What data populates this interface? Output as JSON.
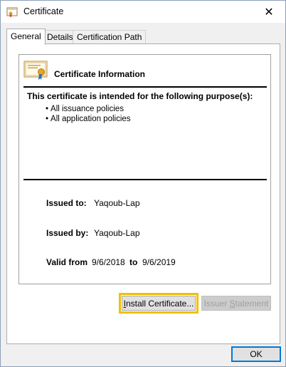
{
  "window": {
    "title": "Certificate"
  },
  "tabs": [
    {
      "label": "General",
      "active": true
    },
    {
      "label": "Details",
      "active": false
    },
    {
      "label": "Certification Path",
      "active": false
    }
  ],
  "info": {
    "title": "Certificate Information",
    "purpose_heading": "This certificate is intended for the following purpose(s):",
    "purposes": [
      "All issuance policies",
      "All application policies"
    ]
  },
  "fields": {
    "issued_to_label": "Issued to:",
    "issued_to_value": "Yaqoub-Lap",
    "issued_by_label": "Issued by:",
    "issued_by_value": "Yaqoub-Lap",
    "valid_from_label": "Valid from",
    "valid_from_value": "9/6/2018",
    "valid_to_label": "to",
    "valid_to_value": "9/6/2019"
  },
  "buttons": {
    "install": {
      "mnemonic": "I",
      "rest": "nstall Certificate..."
    },
    "issuer": {
      "pre": "Issuer ",
      "mnemonic": "S",
      "rest": "tatement"
    },
    "ok": "OK"
  },
  "colors": {
    "focus": "#f0c000",
    "ok_border": "#0078d7"
  }
}
